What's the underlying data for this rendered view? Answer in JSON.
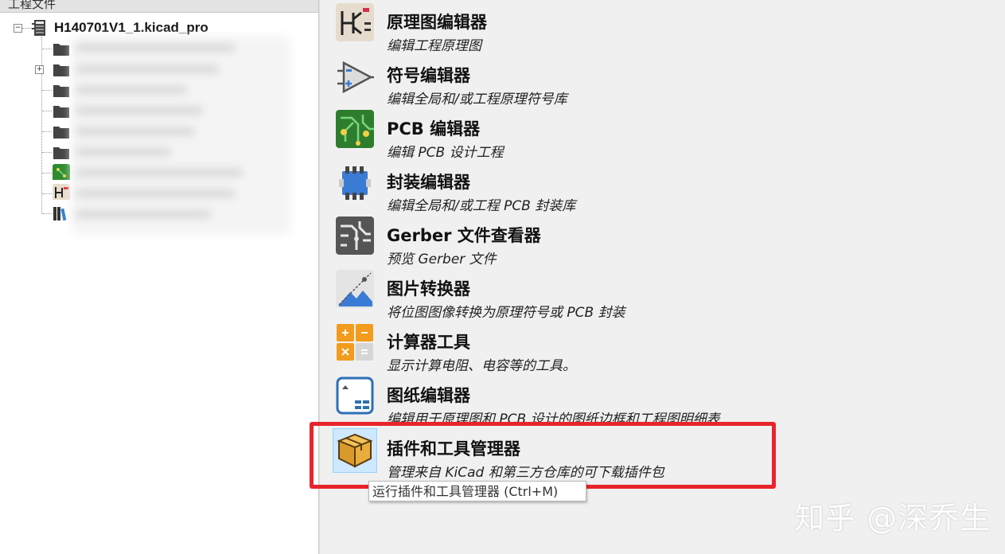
{
  "left_panel": {
    "header": "工程文件",
    "root_item": "H140701V1_1.kicad_pro",
    "child_icons": [
      "folder-icon",
      "folder-icon",
      "folder-icon",
      "folder-icon",
      "folder-icon",
      "folder-icon",
      "pcb-file-icon",
      "schematic-file-icon",
      "library-file-icon"
    ]
  },
  "tools": [
    {
      "title": "原理图编辑器",
      "desc": "编辑工程原理图",
      "icon": "schematic-editor-icon"
    },
    {
      "title": "符号编辑器",
      "desc": "编辑全局和/或工程原理符号库",
      "icon": "symbol-editor-icon"
    },
    {
      "title": "PCB 编辑器",
      "desc": "编辑 PCB 设计工程",
      "icon": "pcb-editor-icon"
    },
    {
      "title": "封装编辑器",
      "desc": "编辑全局和/或工程 PCB 封装库",
      "icon": "footprint-editor-icon"
    },
    {
      "title": "Gerber 文件查看器",
      "desc": "预览 Gerber 文件",
      "icon": "gerber-viewer-icon"
    },
    {
      "title": "图片转换器",
      "desc": "将位图图像转换为原理符号或 PCB 封装",
      "icon": "image-converter-icon"
    },
    {
      "title": "计算器工具",
      "desc": "显示计算电阻、电容等的工具。",
      "icon": "calculator-icon"
    },
    {
      "title": "图纸编辑器",
      "desc": "编辑用于原理图和 PCB 设计的图纸边框和工程图明细表",
      "icon": "drawing-sheet-editor-icon"
    },
    {
      "title": "插件和工具管理器",
      "desc": "管理来自 KiCad 和第三方仓库的可下载插件包",
      "icon": "plugin-manager-icon"
    }
  ],
  "tooltip": "运行插件和工具管理器 (Ctrl+M)",
  "watermark": "知乎 @深乔生",
  "colors": {
    "highlight": "#e8242b",
    "selection": "#cde8ff"
  }
}
